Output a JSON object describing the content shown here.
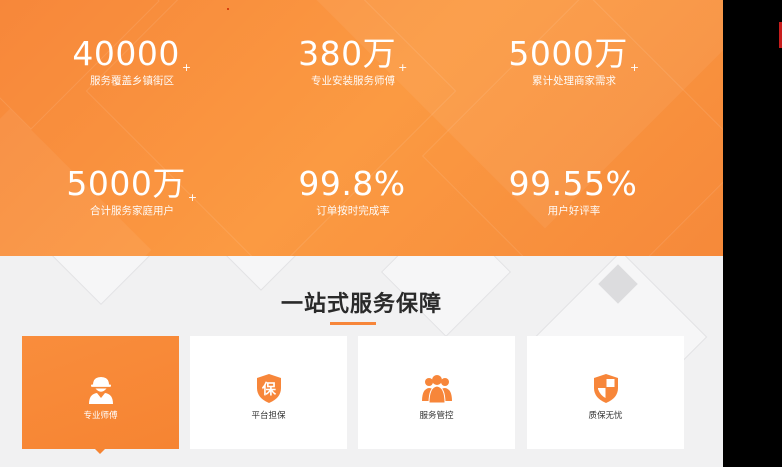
{
  "stats": [
    {
      "value": "40000",
      "plus": "+",
      "label": "服务覆盖乡镇街区"
    },
    {
      "value": "380万",
      "plus": "+",
      "label": "专业安装服务师傅"
    },
    {
      "value": "5000万",
      "plus": "+",
      "label": "累计处理商家需求"
    },
    {
      "value": "5000万",
      "plus": "+",
      "label": "合计服务家庭用户"
    },
    {
      "value": "99.8%",
      "plus": "",
      "label": "订单按时完成率"
    },
    {
      "value": "99.55%",
      "plus": "",
      "label": "用户好评率"
    }
  ],
  "section": {
    "title": "一站式服务保障"
  },
  "cards": [
    {
      "label": "专业师傅",
      "icon": "worker-icon",
      "active": true
    },
    {
      "label": "平台担保",
      "icon": "shield-bao-icon",
      "active": false
    },
    {
      "label": "服务管控",
      "icon": "team-icon",
      "active": false
    },
    {
      "label": "质保无忧",
      "icon": "quality-shield-icon",
      "active": false
    }
  ],
  "colors": {
    "accent": "#f7863a",
    "title": "#2a2a2a"
  }
}
